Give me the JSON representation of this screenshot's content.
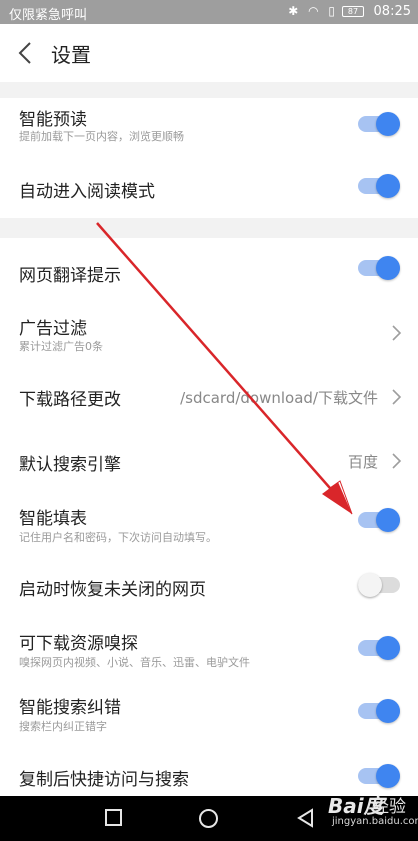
{
  "status_bar": {
    "carrier": "仅限紧急呼叫",
    "battery": "87",
    "time": "08:25"
  },
  "header": {
    "title": "设置"
  },
  "settings": [
    {
      "label": "智能预读",
      "sub": "提前加载下一页内容，浏览更顺畅",
      "toggle": true
    },
    {
      "label": "自动进入阅读模式",
      "toggle": true
    },
    {
      "label": "网页翻译提示",
      "toggle": true
    },
    {
      "label": "广告过滤",
      "sub": "累计过滤广告0条",
      "chevron": true
    },
    {
      "label": "下载路径更改",
      "value": "/sdcard/download/下载文件",
      "chevron": true
    },
    {
      "label": "默认搜索引擎",
      "value": "百度",
      "chevron": true
    },
    {
      "label": "智能填表",
      "sub": "记住用户名和密码，下次访问自动填写。",
      "toggle": true
    },
    {
      "label": "启动时恢复未关闭的网页",
      "toggle": false
    },
    {
      "label": "可下载资源嗅探",
      "sub": "嗅探网页内视频、小说、音乐、迅雷、电驴文件",
      "toggle": true
    },
    {
      "label": "智能搜索纠错",
      "sub": "搜索栏内纠正错字",
      "toggle": true
    },
    {
      "label": "复制后快捷访问与搜索",
      "toggle": true
    }
  ],
  "colors": {
    "accent": "#3f85f0",
    "annotation_arrow": "#d9262a"
  },
  "watermark": {
    "logo": "Bai度",
    "text": "经验",
    "url": "jingyan.baidu.com"
  }
}
